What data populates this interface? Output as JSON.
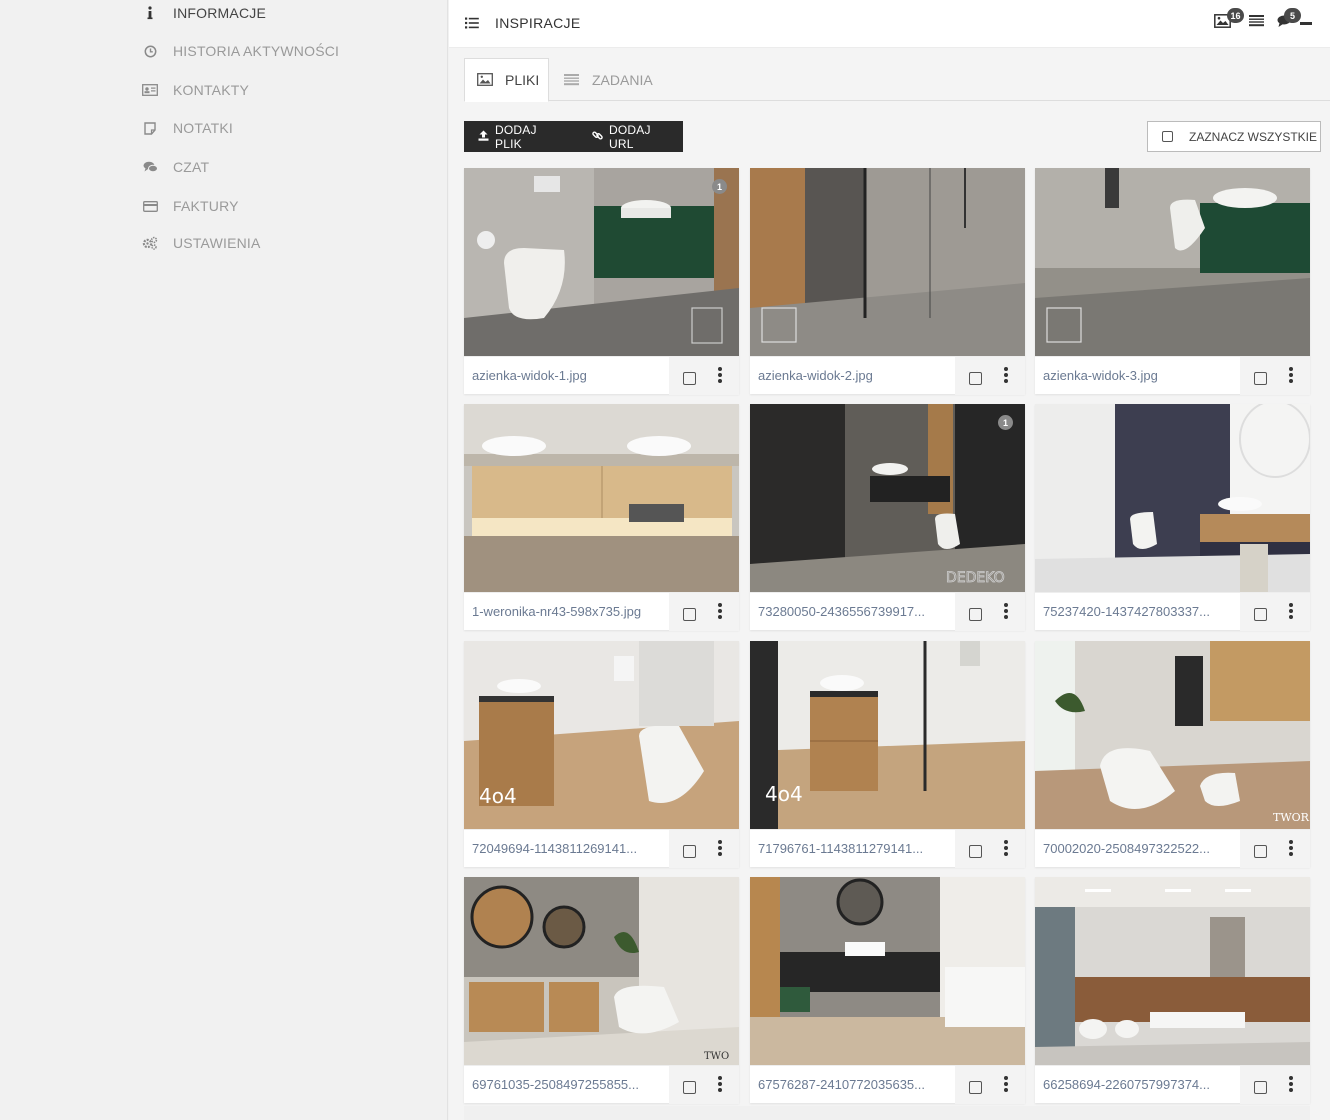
{
  "sidebar": {
    "items": [
      {
        "label": "INFORMACJE",
        "icon": "info-icon",
        "active": true
      },
      {
        "label": "HISTORIA AKTYWNOŚCI",
        "icon": "clock-icon",
        "active": false
      },
      {
        "label": "KONTAKTY",
        "icon": "contact-card-icon",
        "active": false
      },
      {
        "label": "NOTATKI",
        "icon": "note-icon",
        "active": false
      },
      {
        "label": "CZAT",
        "icon": "chat-icon",
        "active": false
      },
      {
        "label": "FAKTURY",
        "icon": "credit-card-icon",
        "active": false
      },
      {
        "label": "USTAWIENIA",
        "icon": "gears-icon",
        "active": false
      }
    ]
  },
  "header": {
    "title": "INSPIRACJE",
    "images_badge": "16",
    "chat_badge": "5"
  },
  "tabs": [
    {
      "label": "PLIKI",
      "icon": "image-icon",
      "active": true
    },
    {
      "label": "ZADANIA",
      "icon": "tasks-icon",
      "active": false
    }
  ],
  "toolbar": {
    "add_file": "DODAJ PLIK",
    "add_url": "DODAJ URL",
    "select_all": "ZAZNACZ WSZYSTKIE"
  },
  "files": [
    {
      "name": "azienka-widok-1.jpg",
      "badge": "1",
      "watermark": ""
    },
    {
      "name": "azienka-widok-2.jpg",
      "badge": "",
      "watermark": ""
    },
    {
      "name": "azienka-widok-3.jpg",
      "badge": "",
      "watermark": ""
    },
    {
      "name": "1-weronika-nr43-598x735.jpg",
      "badge": "",
      "watermark": ""
    },
    {
      "name": "73280050-2436556739917...",
      "badge": "1",
      "watermark": "DEDEKO"
    },
    {
      "name": "75237420-1437427803337...",
      "badge": "",
      "watermark": ""
    },
    {
      "name": "72049694-1143811269141...",
      "badge": "",
      "watermark": "4o4"
    },
    {
      "name": "71796761-1143811279141...",
      "badge": "",
      "watermark": "4o4"
    },
    {
      "name": "70002020-2508497322522...",
      "badge": "",
      "watermark": "TWOR"
    },
    {
      "name": "69761035-2508497255855...",
      "badge": "",
      "watermark": "TWO"
    },
    {
      "name": "67576287-2410772035635...",
      "badge": "",
      "watermark": ""
    },
    {
      "name": "66258694-2260757997374...",
      "badge": "",
      "watermark": ""
    }
  ],
  "colors": {
    "accent_dark": "#2a2a2a",
    "file_name": "#6b7a92",
    "badge": "#4a4a4a"
  }
}
